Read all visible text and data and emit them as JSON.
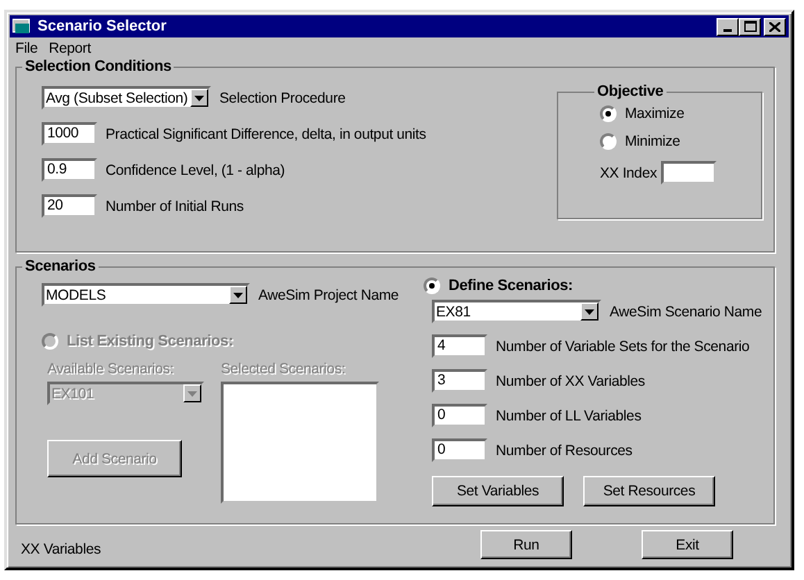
{
  "window": {
    "title": "Scenario Selector"
  },
  "menu": [
    "File",
    "Report"
  ],
  "selection_conditions": {
    "title": "Selection Conditions",
    "procedure": {
      "value": "Avg (Subset Selection)",
      "label": "Selection Procedure"
    },
    "fields": [
      {
        "value": "1000",
        "label": "Practical Significant Difference, delta, in output units"
      },
      {
        "value": "0.9",
        "label": "Confidence Level, (1 - alpha)"
      },
      {
        "value": "20",
        "label": "Number of Initial Runs"
      }
    ],
    "objective": {
      "title": "Objective",
      "options": [
        {
          "label": "Maximize",
          "selected": true
        },
        {
          "label": "Minimize",
          "selected": false
        }
      ],
      "index_label": "XX Index"
    }
  },
  "scenarios": {
    "title": "Scenarios",
    "project": {
      "value": "MODELS",
      "label": "AweSim Project Name"
    },
    "existing": {
      "label": "List Existing Scenarios:",
      "selected": false,
      "disabled": true,
      "available_label": "Available Scenarios:",
      "available_value": "EX101",
      "selected_label": "Selected Scenarios:",
      "add_button": "Add Scenario"
    },
    "define": {
      "label": "Define Scenarios:",
      "selected": true,
      "scenario_name": {
        "value": "EX81",
        "label": "AweSim Scenario Name"
      },
      "fields": [
        {
          "value": "4",
          "label": "Number of Variable Sets for the Scenario"
        },
        {
          "value": "3",
          "label": "Number of XX Variables"
        },
        {
          "value": "0",
          "label": "Number of LL Variables"
        },
        {
          "value": "0",
          "label": "Number of Resources"
        }
      ],
      "buttons": [
        "Set Variables",
        "Set Resources"
      ]
    }
  },
  "status": "XX Variables",
  "buttons": [
    "Run",
    "Exit"
  ]
}
